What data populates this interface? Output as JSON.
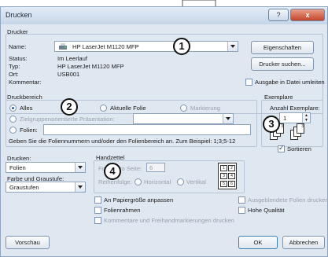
{
  "window": {
    "title": "Drucken",
    "help_label": "?",
    "close_label": "x"
  },
  "printer": {
    "section_label": "Drucker",
    "name_label": "Name:",
    "name_value": "HP LaserJet M1120 MFP",
    "status_label": "Status:",
    "status_value": "Im Leerlauf",
    "type_label": "Typ:",
    "type_value": "HP LaserJet M1120 MFP",
    "location_label": "Ort:",
    "location_value": "USB001",
    "comment_label": "Kommentar:",
    "comment_value": "",
    "properties_button": "Eigenschaften",
    "find_printer_button": "Drucker suchen...",
    "print_to_file_label": "Ausgabe in Datei umleiten",
    "print_to_file_checked": false
  },
  "range": {
    "section_label": "Druckbereich",
    "all_label": "Alles",
    "current_slide_label": "Aktuelle Folie",
    "selection_label": "Markierung",
    "custom_show_label": "Zielgruppenorientierte Präsentation:",
    "custom_show_value": "",
    "slides_label": "Folien:",
    "slides_value": "",
    "hint": "Geben Sie die Foliennummern und/oder den Folienbereich an. Zum Beispiel: 1;3;5-12",
    "selected": "Alles"
  },
  "copies": {
    "section_label": "Exemplare",
    "count_label": "Anzahl Exemplare:",
    "count_value": "1",
    "collate_label": "Sortieren",
    "collate_checked": true,
    "collate_page_numbers": [
      "1",
      "2",
      "3",
      "1",
      "2",
      "3"
    ]
  },
  "print_what": {
    "label": "Drucken:",
    "value": "Folien",
    "color_label": "Farbe und Graustufe:",
    "color_value": "Graustufen"
  },
  "handouts": {
    "section_label": "Handzettel",
    "per_page_label": "Folien pro Seite:",
    "per_page_value": "6",
    "order_label": "Reihenfolge:",
    "horizontal_label": "Horizontal",
    "vertical_label": "Vertikal",
    "preview_numbers": [
      "1",
      "2",
      "3",
      "4",
      "5",
      "6"
    ]
  },
  "options": {
    "scale_to_fit_label": "An Papiergröße anpassen",
    "frame_slides_label": "Folienrahmen",
    "comments_label": "Kommentare und Freihandmarkierungen drucken",
    "hidden_slides_label": "Ausgeblendete Folien drucken",
    "high_quality_label": "Hohe Qualität"
  },
  "footer": {
    "preview_button": "Vorschau",
    "ok_button": "OK",
    "cancel_button": "Abbrechen"
  },
  "callouts": [
    "1",
    "2",
    "3",
    "4"
  ]
}
